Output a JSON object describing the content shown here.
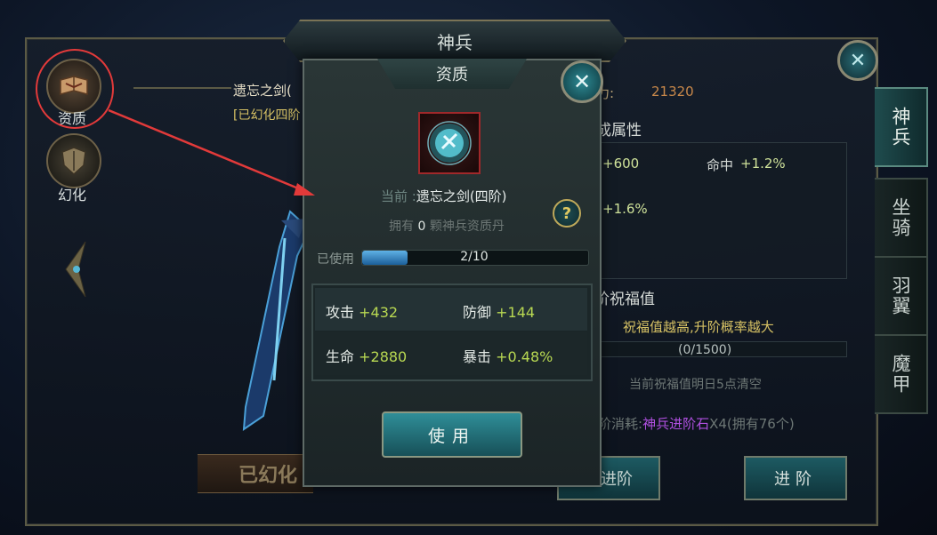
{
  "window": {
    "title": "神兵",
    "close_icon": "✕"
  },
  "left_menu": [
    {
      "label": "资质",
      "icon": "book-icon"
    },
    {
      "label": "幻化",
      "icon": "shield-icon"
    }
  ],
  "background": {
    "weapon_name": "遗忘之剑(",
    "weapon_state": "[已幻化四阶",
    "huanhua_button": "已幻化",
    "power_label": "力:",
    "power_value": "21320",
    "section_attrs_title": "成属性",
    "attrs": [
      {
        "value": "+600"
      },
      {
        "label": "命中",
        "value": "+1.2%"
      },
      {
        "value": "+1.6%"
      }
    ],
    "section_bless_title": "阶祝福值",
    "bless_hint": "祝福值越高,升阶概率越大",
    "bless_count": "(0/1500)",
    "bless_clear": "当前祝福值明日5点清空",
    "cost_prefix": "阶消耗:",
    "cost_item": "神兵进阶石",
    "cost_suffix": "X4(拥有",
    "cost_owned": "76",
    "cost_close": "个)",
    "auto_button": "动进阶",
    "advance_button": "进阶"
  },
  "tabs": [
    {
      "label": "神兵",
      "active": true
    },
    {
      "label": "坐骑",
      "active": false
    },
    {
      "label": "羽翼",
      "active": false
    },
    {
      "label": "魔甲",
      "active": false
    }
  ],
  "popup": {
    "title": "资质",
    "close_icon": "✕",
    "current_label": "当前 :",
    "current_value": "遗忘之剑(四阶)",
    "own_prefix": "拥有",
    "own_count": "0",
    "own_suffix": "颗神兵资质丹",
    "help_icon": "?",
    "used_label": "已使用",
    "used_text": "2/10",
    "used_value": 2,
    "used_max": 10,
    "stats": [
      {
        "label": "攻击",
        "value": "+432"
      },
      {
        "label": "防御",
        "value": "+144"
      },
      {
        "label": "生命",
        "value": "+2880"
      },
      {
        "label": "暴击",
        "value": "+0.48%"
      }
    ],
    "use_button": "使用"
  },
  "colors": {
    "highlight_circle": "#e23a3a",
    "stat_value": "#b8d852",
    "cost_item": "#b050e0",
    "accent_teal": "#2f8e98"
  }
}
